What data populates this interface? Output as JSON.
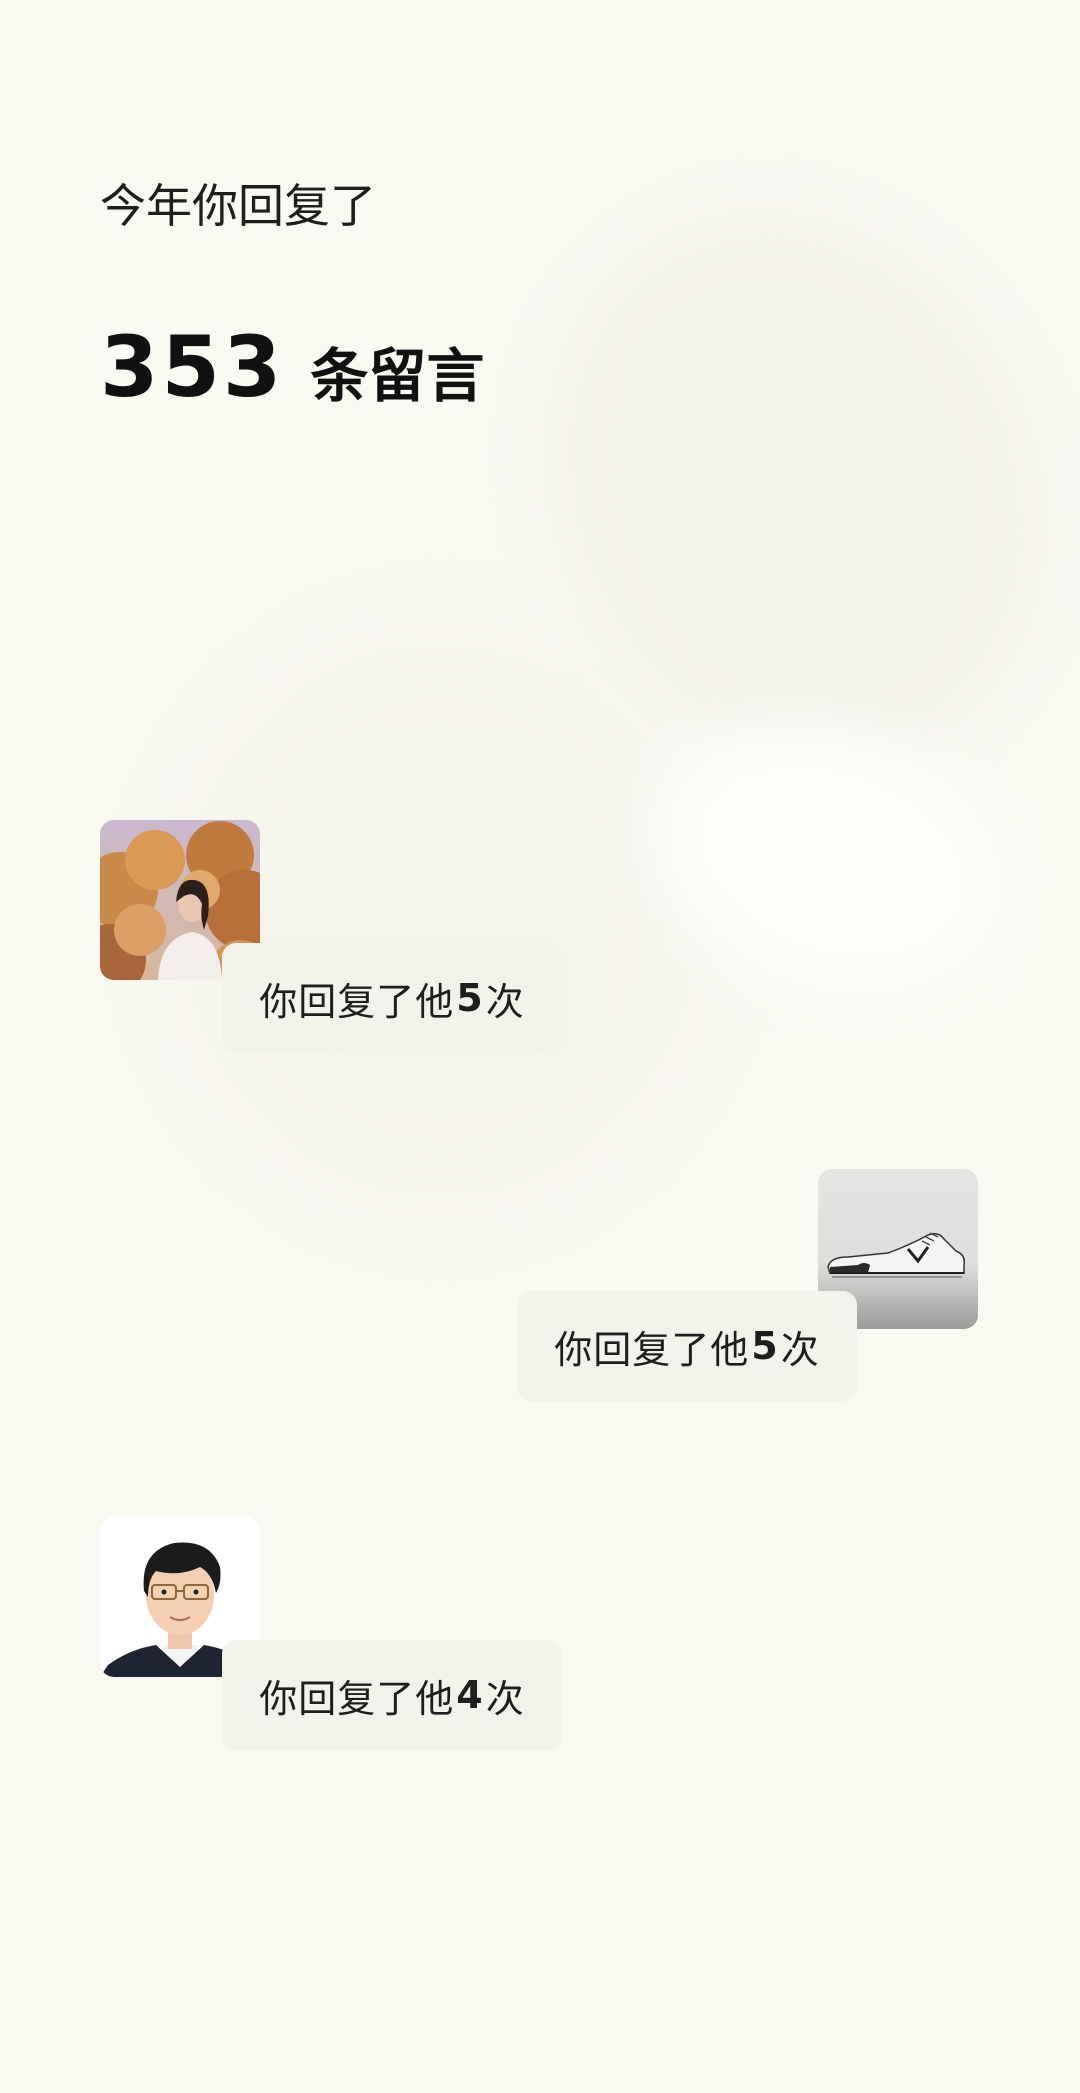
{
  "header": {
    "title": "今年你回复了",
    "count": "353",
    "count_unit": "条留言"
  },
  "contacts": [
    {
      "prefix": "你回复了他",
      "times": "5",
      "suffix": "次",
      "avatar": "woman-in-autumn-trees-photo"
    },
    {
      "prefix": "你回复了他",
      "times": "5",
      "suffix": "次",
      "avatar": "sneaker-sketch"
    },
    {
      "prefix": "你回复了他",
      "times": "4",
      "suffix": "次",
      "avatar": "cartoon-man-with-glasses"
    }
  ]
}
